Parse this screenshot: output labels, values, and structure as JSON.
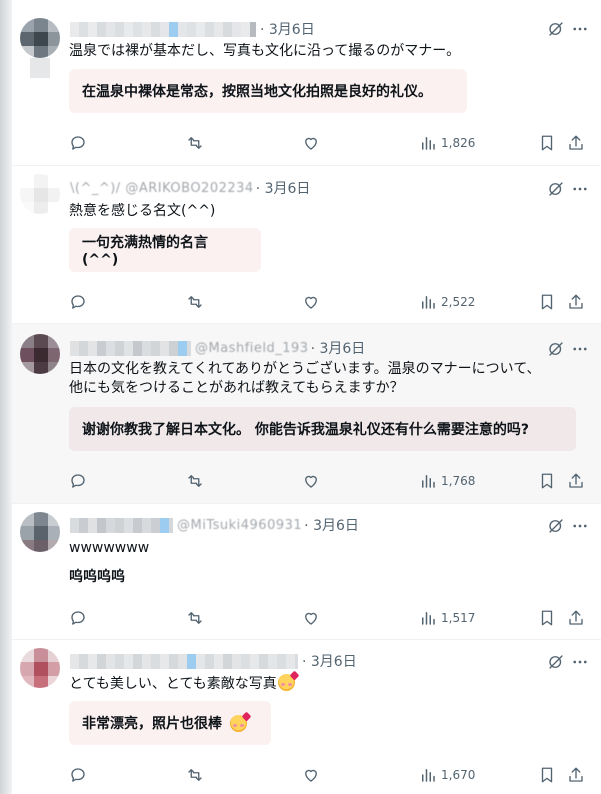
{
  "colors": {
    "text": "#0f1419",
    "muted": "#536471",
    "translation_bg": "#fbf1f1",
    "shaded_bg": "#f7f7f7"
  },
  "icons": [
    "reply-icon",
    "repost-icon",
    "like-icon",
    "views-icon",
    "bookmark-icon",
    "share-icon",
    "grok-icon",
    "more-icon"
  ],
  "posts": [
    {
      "handle": "",
      "date": "· 3月6日",
      "text": "温泉では裸が基本だし、写真も文化に沿って撮るのがマナー。",
      "translation": "在温泉中裸体是常态，按照当地文化拍照是良好的礼仪。",
      "views": "1,826"
    },
    {
      "handle": "\\(^_^)/ @ARIKOBO202234",
      "date": "· 3月6日",
      "text": "熱意を感じる名文(^^)",
      "translation": "一句充满热情的名言 (^^)",
      "views": "2,522"
    },
    {
      "handle": "@Mashfield_193",
      "date": "· 3月6日",
      "text_line1": "日本の文化を教えてくれてありがとうございます。温泉のマナーについて、",
      "text_line2": "他にも気をつけることがあれば教えてもらえますか？",
      "translation": "谢谢你教我了解日本文化。 你能告诉我温泉礼仪还有什么需要注意的吗?",
      "views": "1,768"
    },
    {
      "handle": "@MiTsuki4960931",
      "date": "· 3月6日",
      "text": "wwwwwww",
      "translation": "呜呜呜呜",
      "views": "1,517"
    },
    {
      "handle": "",
      "date": "· 3月6日",
      "text": "とても美しい、とても素敵な写真",
      "translation": "非常漂亮，照片也很棒",
      "views": "1,670"
    }
  ]
}
